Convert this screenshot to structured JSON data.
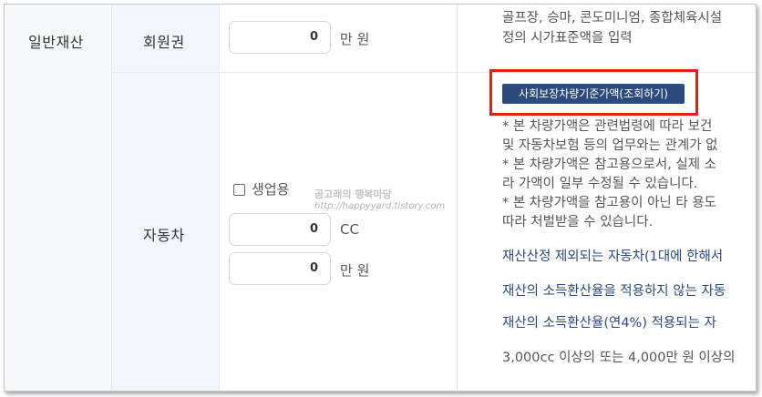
{
  "category": "일반재산",
  "membership": {
    "label": "회원권",
    "value": "0",
    "unit": "만 원",
    "desc_lines": [
      "골프장, 승마, 콘도미니엄, 종합체육시설",
      "정의 시가표준액을 입력"
    ]
  },
  "vehicle": {
    "label": "자동차",
    "business_use_label": "생업용",
    "cc_value": "0",
    "cc_unit": "CC",
    "price_value": "0",
    "price_unit": "만 원",
    "lookup_button": "사회보장차량기준가액(조회하기)",
    "notes": [
      "* 본 차량가액은 관련법령에 따라 보건",
      "및 자동차보험 등의 업무와는 관계가 없",
      "* 본 차량가액은 참고용으로서, 실제 소",
      "라 가액이 일부 수정될 수 있습니다.",
      "* 본 차량가액을 참고용이 아닌 타 용도",
      "따라 처벌받을 수 있습니다."
    ],
    "links": [
      "재산산정 제외되는 자동차(1대에 한해서",
      "재산의 소득환산율을 적용하지 않는 자동",
      "재산의 소득환산율(연4%) 적용되는 자"
    ],
    "footnote": "3,000cc 이상의 또는 4,000만 원 이상의"
  },
  "watermark": {
    "title": "곰고래의 행복마당",
    "url": "http://happyyard.tistory.com"
  },
  "colors": {
    "button_bg": "#2c4a7c",
    "highlight_border": "#e0201e",
    "link_text": "#2c4a7c"
  }
}
